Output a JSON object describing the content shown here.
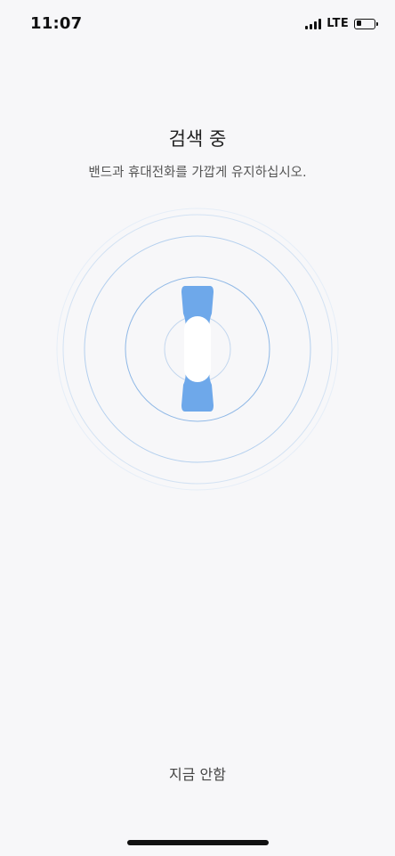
{
  "status_bar": {
    "time": "11:07",
    "network": "LTE",
    "battery_level": 0.3
  },
  "search": {
    "title": "검색 중",
    "subtitle": "밴드과 휴대전화를 가깝게 유지하십시오."
  },
  "actions": {
    "skip_label": "지금 안함"
  },
  "colors": {
    "band": "#6ea8ea",
    "ring": "#a9c8ec",
    "background": "#f7f7f9"
  },
  "icons": {
    "band": "smart-band-icon",
    "signal": "cellular-signal-icon",
    "battery": "battery-icon"
  }
}
